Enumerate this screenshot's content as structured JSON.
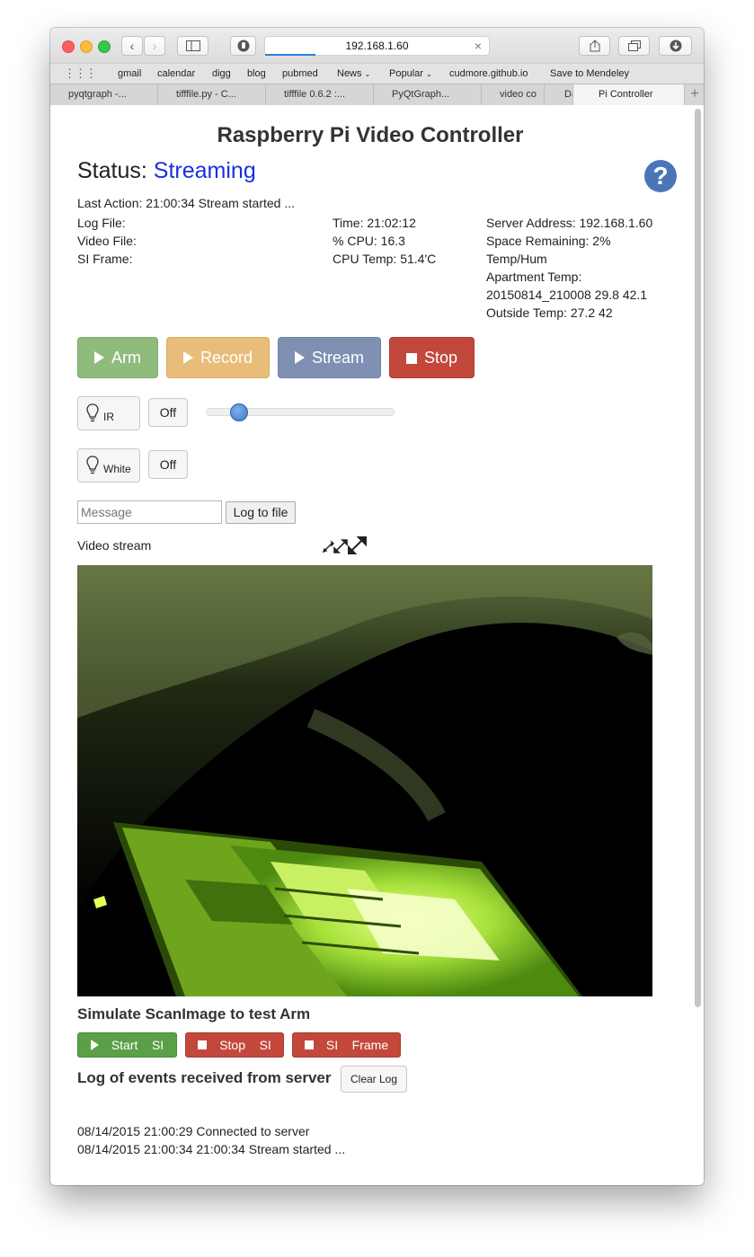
{
  "browser": {
    "url": "192.168.1.60",
    "favorites": [
      "gmail",
      "calendar",
      "digg",
      "blog",
      "pubmed",
      "News",
      "Popular",
      "cudmore.github.io",
      "Save to Mendeley"
    ],
    "tabs": [
      "pyqtgraph -...",
      "tifffile.py - C...",
      "tifffile 0.6.2 :...",
      "PyQtGraph...",
      "video co",
      "Da",
      "Pi Controller"
    ]
  },
  "page": {
    "title": "Raspberry Pi Video Controller",
    "status_label": "Status:",
    "status_value": "Streaming",
    "help_glyph": "?",
    "last_action": "Last Action: 21:00:34 Stream started ...",
    "col1": [
      "Log File:",
      "Video File:",
      "SI Frame:"
    ],
    "col2": [
      "Time: 21:02:12",
      "% CPU: 16.3",
      "CPU Temp: 51.4'C"
    ],
    "col3": [
      "Server Address: 192.168.1.60",
      "Space Remaining: 2%",
      "Temp/Hum",
      "Apartment Temp:",
      "20150814_210008 29.8 42.1",
      "Outside Temp: 27.2 42"
    ]
  },
  "controls": {
    "arm": "Arm",
    "record": "Record",
    "stream": "Stream",
    "stop": "Stop",
    "ir_label": "IR",
    "ir_state": "Off",
    "ir_slider_fraction": 0.14,
    "white_label": "White",
    "white_state": "Off",
    "message_placeholder": "Message",
    "log_to_file": "Log to file",
    "video_stream_label": "Video stream"
  },
  "simulate": {
    "heading": "Simulate ScanImage to test Arm",
    "start_si": [
      "Start",
      "SI"
    ],
    "stop_si": [
      "Stop",
      "SI"
    ],
    "si_frame": [
      "SI",
      "Frame"
    ]
  },
  "log": {
    "heading": "Log of events received from server",
    "clear": "Clear Log",
    "entries": [
      "08/14/2015 21:00:29 Connected to server",
      "08/14/2015 21:00:34 21:00:34 Stream started ..."
    ]
  },
  "colors": {
    "arm": "#8fbb7d",
    "record": "#e8bd7a",
    "stream": "#7f90b3",
    "stop": "#c3483c",
    "start_si": "#5b9f47",
    "status_value": "#1a2fe0",
    "help": "#4a76b8"
  }
}
